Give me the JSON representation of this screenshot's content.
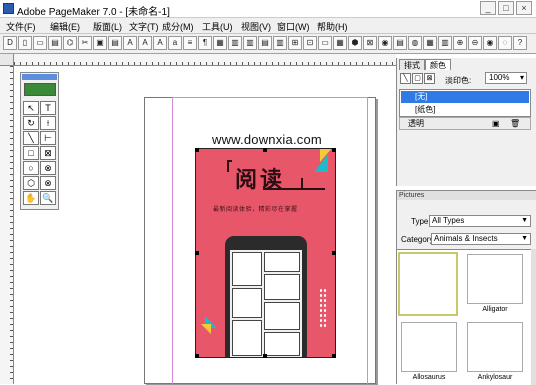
{
  "window": {
    "title": "Adobe PageMaker 7.0 - [未命名-1]",
    "controls": [
      "_",
      "□",
      "×"
    ]
  },
  "menu": {
    "items": [
      "文件(F)",
      "编辑(E)",
      "版面(L)",
      "文字(T)",
      "成分(M)",
      "工具(U)",
      "视图(V)",
      "窗口(W)",
      "帮助(H)"
    ]
  },
  "toolbar": {
    "glyphs": [
      "D",
      "▯",
      "▭",
      "▤",
      "⌬",
      "✂",
      "▣",
      "▤",
      "A",
      "A",
      "A",
      "a",
      "≡",
      "¶",
      "▦",
      "▥",
      "▥",
      "▤",
      "▥",
      "⊞",
      "⊡",
      "▭",
      "▦",
      "⬢",
      "⊠",
      "◉",
      "▤",
      "◍",
      "▦",
      "▥",
      "⊕",
      "⊖",
      "◉",
      "◌",
      "?"
    ]
  },
  "toolbox": {
    "tools": [
      "↖",
      "T",
      "↻",
      "⟊",
      "╲",
      "⊢",
      "□",
      "⊠",
      "○",
      "⊗",
      "⬡",
      "⊗",
      "✋",
      "🔍"
    ]
  },
  "document": {
    "watermark": "www.downxia.com",
    "book": {
      "title": "阅读",
      "tagline": "最新阅读体验，精彩尽在掌握"
    }
  },
  "colors_panel": {
    "tabs": [
      "排式",
      "颜色"
    ],
    "tint_label": "淡印色:",
    "tint_value": "100%",
    "rows": [
      "[无]",
      "[纸色]"
    ],
    "footer": "透明",
    "accent": "#2f7ae5"
  },
  "pictures_panel": {
    "title": "Pictures",
    "type_label": "Type:",
    "type_value": "All Types",
    "category_label": "Category:",
    "category_value": "Animals & Insects",
    "thumbs": [
      {
        "caption": ""
      },
      {
        "caption": "Alligator"
      },
      {
        "caption": "Allosaurus"
      },
      {
        "caption": "Ankylosaur"
      }
    ]
  }
}
